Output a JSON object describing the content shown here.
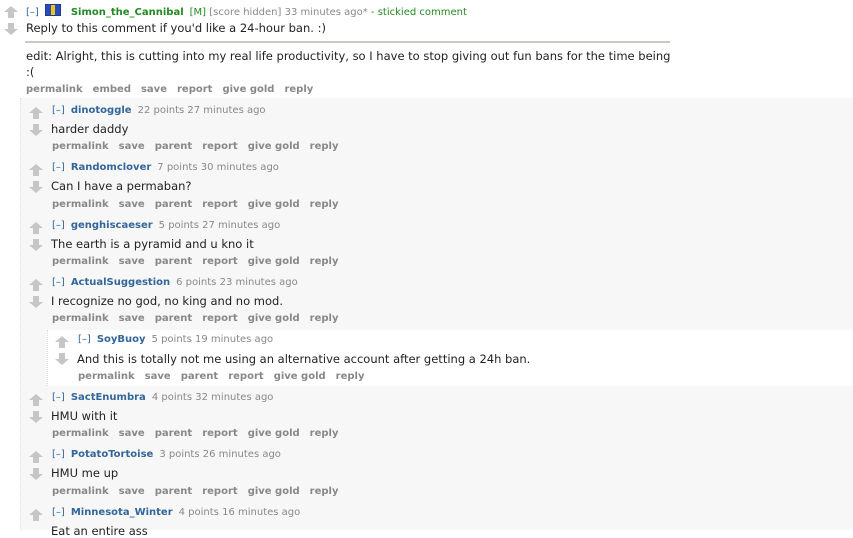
{
  "parent": {
    "expand": "[–]",
    "author": "Simon_the_Cannibal",
    "mod_tag": "[M]",
    "score": "[score hidden]",
    "time": "33 minutes ago*",
    "sticky": "- stickied comment",
    "line1": "Reply to this comment if you'd like a 24-hour ban. :)",
    "edit_line1": "edit: Alright, this is cutting into my real life productivity, so I have to stop giving out fun bans for the time being",
    "edit_line2": ":(",
    "buttons": [
      "permalink",
      "embed",
      "save",
      "report",
      "give gold",
      "reply"
    ]
  },
  "replies": [
    {
      "expand": "[–]",
      "author": "dinotoggle",
      "points": "22 points",
      "time": "27 minutes ago",
      "text": "harder daddy"
    },
    {
      "expand": "[–]",
      "author": "Randomclover",
      "points": "7 points",
      "time": "30 minutes ago",
      "text": "Can I have a permaban?"
    },
    {
      "expand": "[–]",
      "author": "genghiscaeser",
      "points": "5 points",
      "time": "27 minutes ago",
      "text": "The earth is a pyramid and u kno it"
    },
    {
      "expand": "[–]",
      "author": "ActualSuggestion",
      "points": "6 points",
      "time": "23 minutes ago",
      "text": "I recognize no god, no king and no mod."
    },
    {
      "expand": "[–]",
      "author": "SoyBuoy",
      "points": "5 points",
      "time": "19 minutes ago",
      "text": "And this is totally not me using an alternative account after getting a 24h ban."
    },
    {
      "expand": "[–]",
      "author": "SactEnumbra",
      "points": "4 points",
      "time": "32 minutes ago",
      "text": "HMU with it"
    },
    {
      "expand": "[–]",
      "author": "PotatoTortoise",
      "points": "3 points",
      "time": "26 minutes ago",
      "text": "HMU me up"
    },
    {
      "expand": "[–]",
      "author": "Minnesota_Winter",
      "points": "4 points",
      "time": "16 minutes ago",
      "text": "Eat an entire ass"
    }
  ],
  "reply_buttons": [
    "permalink",
    "save",
    "parent",
    "report",
    "give gold",
    "reply"
  ]
}
